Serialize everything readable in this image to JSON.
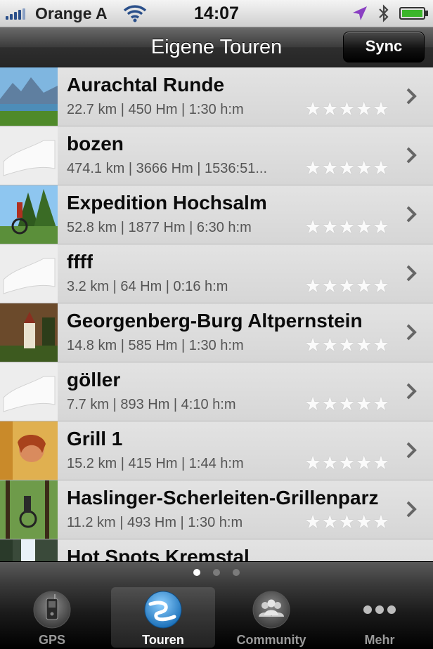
{
  "status_bar": {
    "carrier": "Orange A",
    "time": "14:07"
  },
  "nav": {
    "title": "Eigene Touren",
    "sync_label": "Sync"
  },
  "tours": [
    {
      "name": "Aurachtal Runde",
      "details": "22.7 km | 450 Hm | 1:30 h:m",
      "rating": "★★★★★",
      "thumb": "mountain-lake-photo"
    },
    {
      "name": "bozen",
      "details": "474.1 km | 3666 Hm | 1536:51...",
      "rating": "★★★★★",
      "thumb": "placeholder-route-icon"
    },
    {
      "name": "Expedition Hochsalm",
      "details": "52.8 km | 1877 Hm | 6:30 h:m",
      "rating": "★★★★★",
      "thumb": "mountainbike-photo"
    },
    {
      "name": "ffff",
      "details": "3.2 km | 64 Hm | 0:16 h:m",
      "rating": "★★★★★",
      "thumb": "placeholder-route-icon"
    },
    {
      "name": "Georgenberg-Burg Altpernstein",
      "details": "14.8 km | 585 Hm | 1:30 h:m",
      "rating": "★★★★★",
      "thumb": "chapel-photo"
    },
    {
      "name": "göller",
      "details": "7.7 km | 893 Hm | 4:10 h:m",
      "rating": "★★★★★",
      "thumb": "placeholder-route-icon"
    },
    {
      "name": "Grill 1",
      "details": "15.2 km | 415 Hm | 1:44 h:m",
      "rating": "★★★★★",
      "thumb": "child-photo"
    },
    {
      "name": "Haslinger-Scherleiten-Grillenparz",
      "details": "11.2 km | 493 Hm | 1:30 h:m",
      "rating": "★★★★★",
      "thumb": "forest-biker-photo"
    },
    {
      "name": "Hot Spots Kremstal",
      "details": "",
      "rating": "",
      "thumb": "waterfall-photo"
    }
  ],
  "pager": {
    "pages": 3,
    "current": 1
  },
  "tabs": [
    {
      "label": "GPS",
      "icon": "phone-gps-icon",
      "selected": false
    },
    {
      "label": "Touren",
      "icon": "route-globe-icon",
      "selected": true
    },
    {
      "label": "Community",
      "icon": "people-group-icon",
      "selected": false
    },
    {
      "label": "Mehr",
      "icon": "more-dots-icon",
      "selected": false
    }
  ],
  "colors": {
    "nav_bar": "#3c3c3c",
    "list_background": "#d9d9d9",
    "selected_tab_icon": "#2f8fd8"
  }
}
